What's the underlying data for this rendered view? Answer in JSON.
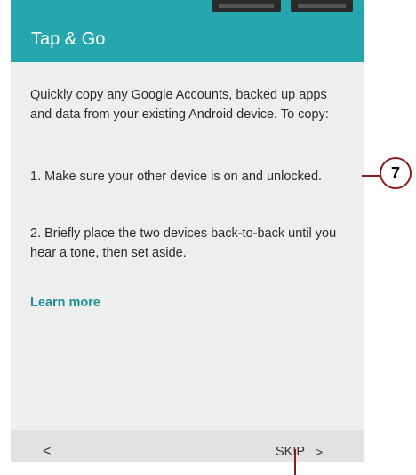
{
  "header": {
    "title": "Tap & Go",
    "color": "#26a6ad"
  },
  "content": {
    "intro": "Quickly copy any Google Accounts, backed up apps and data from your existing Android device. To copy:",
    "step1": "1. Make sure your other device is on and unlocked.",
    "step2": "2. Briefly place the two devices back-to-back until you hear a tone, then set aside.",
    "learn_more": "Learn more"
  },
  "footer": {
    "back_glyph": "<",
    "skip_label": "SKIP",
    "next_glyph": ">"
  },
  "callouts": {
    "step_number": "7",
    "color": "#8e1a1a"
  }
}
